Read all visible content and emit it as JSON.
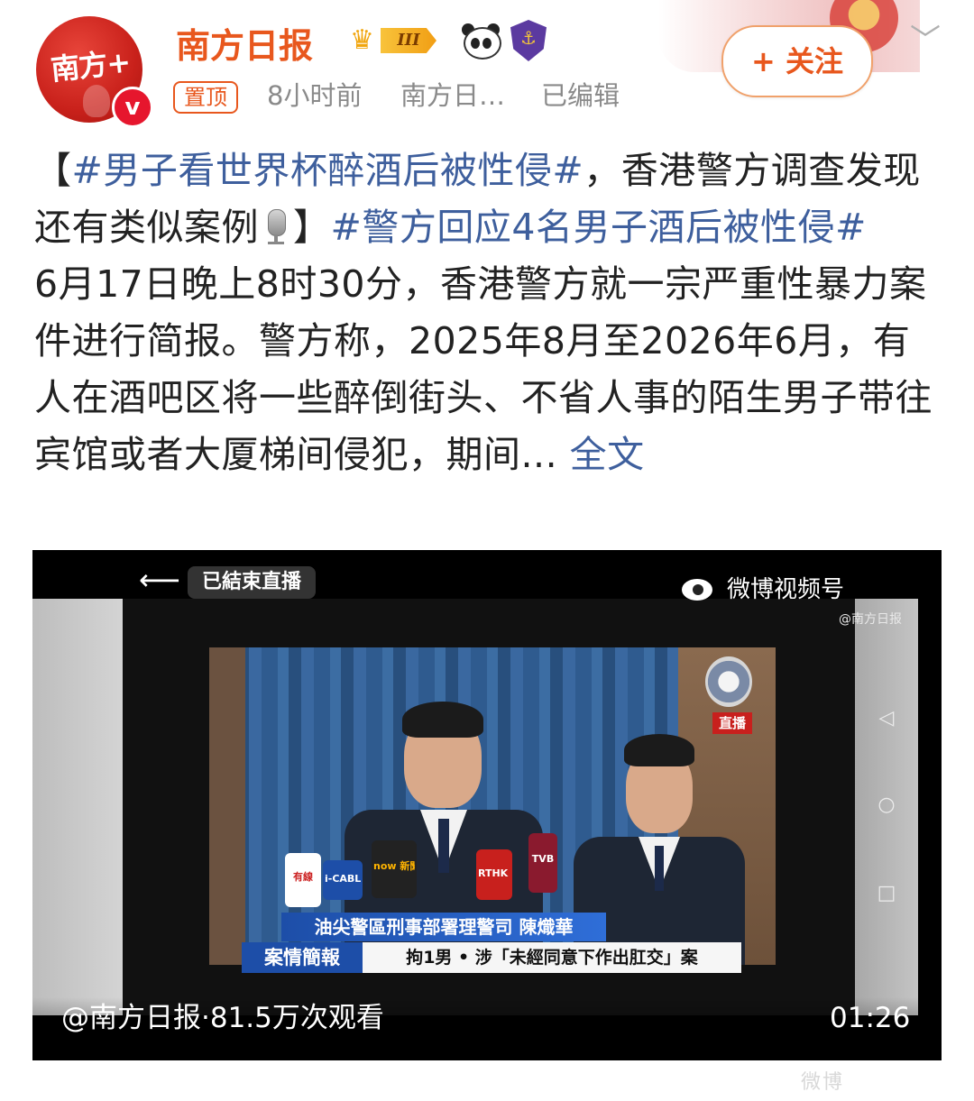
{
  "header": {
    "avatar_text": "南方+",
    "verified_mark": "v",
    "account_name": "南方日报",
    "level_badge": "III",
    "pinned_label": "置顶",
    "time": "8小时前",
    "source": "南方日…",
    "edited": "已编辑",
    "follow_label": "+ 关注",
    "icons": {
      "crown": "crown-icon",
      "panda": "panda-icon",
      "shield": "shield-icon",
      "chevron": "chevron-down-icon"
    }
  },
  "post": {
    "segments": [
      {
        "text": "【",
        "type": "plain"
      },
      {
        "text": "#男子看世界杯醉酒后被性侵#",
        "type": "hashtag"
      },
      {
        "text": "，香港警方调查发现还有类似案例",
        "type": "plain"
      },
      {
        "text": "mic",
        "type": "icon"
      },
      {
        "text": "】",
        "type": "plain"
      },
      {
        "text": "#警方回应4名男子酒后被性侵#",
        "type": "hashtag"
      }
    ],
    "body": "6月17日晚上8时30分，香港警方就一宗严重性暴力案件进行简报。警方称，2025年8月至2026年6月，有人在酒吧区将一些醉倒街头、不省人事的陌生男子带往宾馆或者大厦梯间侵犯，期间...",
    "full_text_link": "全文"
  },
  "video": {
    "ended_label": "已結束直播",
    "channel_name": "微博视频号",
    "channel_handle": "@南方日报",
    "live_tag": "直播",
    "caption_top": "油尖警區刑事部署理警司 陳熾華",
    "caption_left": "案情簡報",
    "caption_right": "拘1男 • 涉「未經同意下作出肛交」案",
    "mic_tags": [
      "有線",
      "now 新聞台",
      "RTHK 香港電台",
      "TVB",
      "i-CABLE"
    ],
    "info": "@南方日报·81.5万次观看",
    "duration": "01:26"
  },
  "watermark": "微博"
}
